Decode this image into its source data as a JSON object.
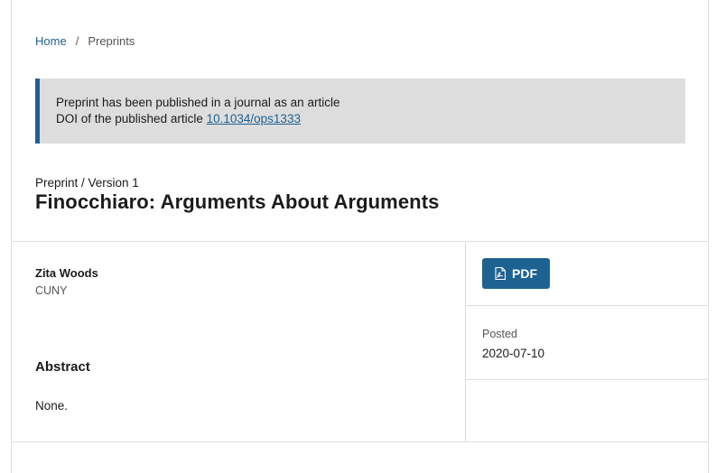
{
  "breadcrumb": {
    "home": "Home",
    "separator": "/",
    "current": "Preprints"
  },
  "notice": {
    "line1": "Preprint has been published in a journal as an article",
    "doi_label": "DOI of the published article",
    "doi_link": "10.1034/ops1333"
  },
  "article": {
    "version": "Preprint / Version 1",
    "title": "Finocchiaro: Arguments About Arguments"
  },
  "author": {
    "name": "Zita Woods",
    "affiliation": "CUNY"
  },
  "abstract": {
    "heading": "Abstract",
    "text": "None."
  },
  "galley": {
    "pdf_label": "PDF",
    "icon": "file-pdf-icon"
  },
  "posted": {
    "label": "Posted",
    "date": "2020-07-10"
  },
  "colors": {
    "accent": "#1e6292",
    "notice_bg": "#dddddd",
    "border": "#dddddd"
  }
}
